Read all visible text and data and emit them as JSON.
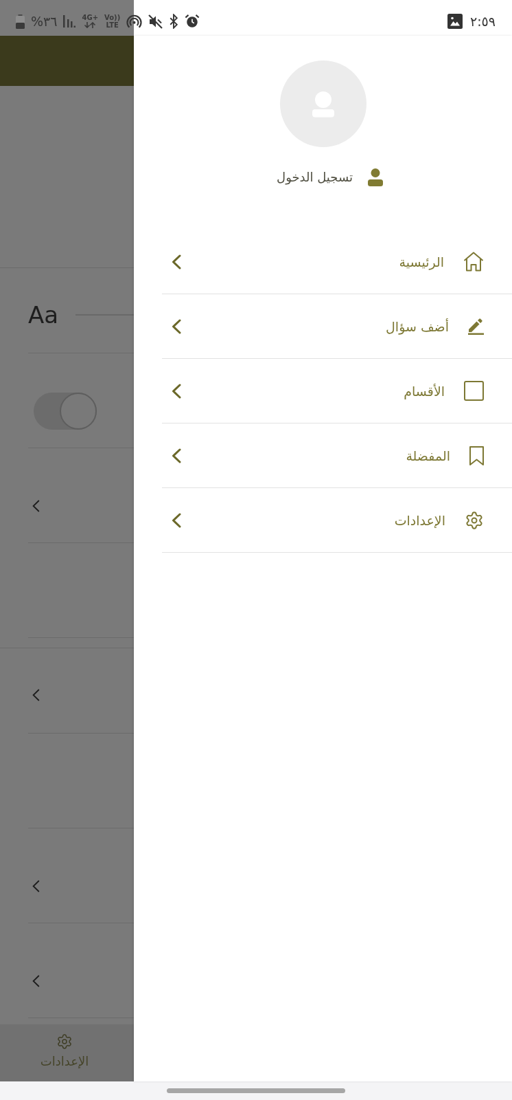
{
  "status_bar": {
    "battery": "%٣٦",
    "network": "4G+",
    "volte_top": "Vo))",
    "volte_bottom": "LTE",
    "time": "٢:٥٩"
  },
  "background": {
    "sections": [
      {
        "rows": [
          {
            "kind": "font_size",
            "sample": "Aa"
          },
          {
            "kind": "switch",
            "on": false
          },
          {
            "kind": "link"
          },
          {
            "kind": "blank"
          }
        ]
      },
      {
        "rows": [
          {
            "kind": "link"
          },
          {
            "kind": "blank"
          },
          {
            "kind": "link"
          },
          {
            "kind": "link"
          }
        ]
      }
    ],
    "bottom_nav": [
      {
        "label": "الإعدادات",
        "selected": true
      }
    ]
  },
  "drawer": {
    "login": {
      "label": "تسجيل الدخول"
    },
    "menu": [
      {
        "label": "الرئيسية"
      },
      {
        "label": "أضف سؤال"
      },
      {
        "label": "الأقسام"
      },
      {
        "label": "المفضلة"
      },
      {
        "label": "الإعدادات"
      }
    ]
  }
}
